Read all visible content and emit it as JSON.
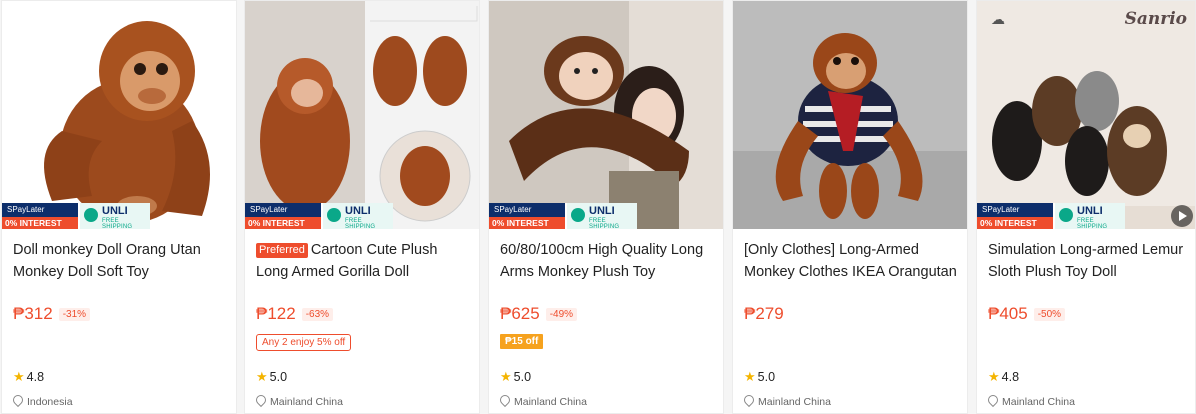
{
  "badges": {
    "spaylater": "SPayLater",
    "interest": "0% INTEREST",
    "unli": "UNLI",
    "free_shipping": "FREE SHIPPING"
  },
  "products": [
    {
      "title": "Doll monkey Doll Orang Utan Monkey Doll Soft Toy",
      "price": "₱312",
      "discount": "-31%",
      "rating": "4.8",
      "location": "Indonesia"
    },
    {
      "tag": "Preferred",
      "title": "Cartoon Cute Plush Long Armed Gorilla Doll",
      "price": "₱122",
      "discount": "-63%",
      "promo": "Any 2 enjoy 5% off",
      "rating": "5.0",
      "location": "Mainland China"
    },
    {
      "title": "60/80/100cm High Quality Long Arms Monkey Plush Toy",
      "price": "₱625",
      "discount": "-49%",
      "promo": "₱15 off",
      "rating": "5.0",
      "location": "Mainland China"
    },
    {
      "title": "[Only Clothes] Long-Armed Monkey Clothes IKEA Orangutan",
      "price": "₱279",
      "rating": "5.0",
      "location": "Mainland China"
    },
    {
      "title": "Simulation Long-armed Lemur Sloth Plush Toy Doll",
      "price": "₱405",
      "discount": "-50%",
      "rating": "4.8",
      "location": "Mainland China",
      "brand": "Sanrio"
    }
  ]
}
